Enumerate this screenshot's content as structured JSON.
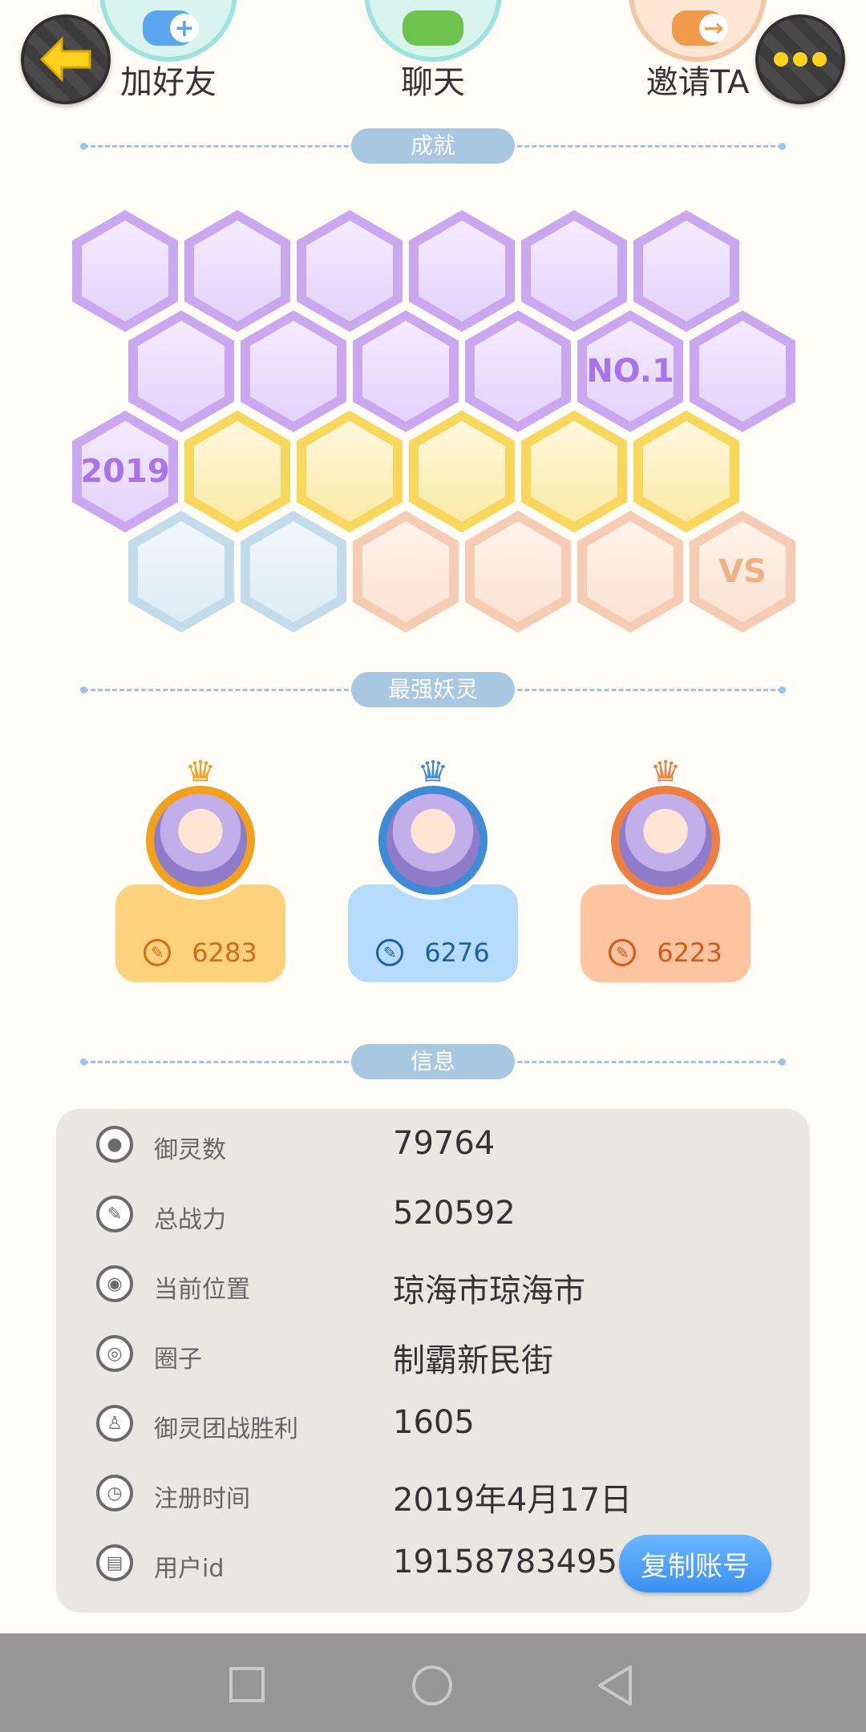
{
  "top_actions": [
    {
      "label": "加好友",
      "icon": "add-friend-icon"
    },
    {
      "label": "聊天",
      "icon": "chat-icon"
    },
    {
      "label": "邀请TA",
      "icon": "invite-icon"
    }
  ],
  "back_button": {
    "icon": "back-arrow-icon"
  },
  "more_button": {
    "icon": "more-dots-icon"
  },
  "sections": {
    "achievements": "成就",
    "strongest": "最强妖灵",
    "info": "信息"
  },
  "achievements": [
    {
      "icon": "sneaker-badge",
      "color": "purple",
      "text": ""
    },
    {
      "icon": "lollipop-badge",
      "color": "purple",
      "text": ""
    },
    {
      "icon": "devil-badge",
      "color": "purple",
      "text": ""
    },
    {
      "icon": "crystal-ball-badge",
      "color": "purple",
      "text": ""
    },
    {
      "icon": "gem-badge",
      "color": "purple",
      "text": ""
    },
    {
      "icon": "yinyang-comet-badge",
      "color": "purple",
      "text": ""
    },
    {
      "icon": "cat-badge",
      "color": "purple",
      "text": ""
    },
    {
      "icon": "fairy-badge",
      "color": "purple",
      "text": ""
    },
    {
      "icon": "monster-badge",
      "color": "purple",
      "text": ""
    },
    {
      "icon": "unicorn-badge",
      "color": "purple",
      "text": ""
    },
    {
      "icon": "no1-badge",
      "color": "purple",
      "text": "NO.1"
    },
    {
      "icon": "fist-badge",
      "color": "purple",
      "text": ""
    },
    {
      "icon": "year-2019-badge",
      "color": "purple",
      "text": "2019"
    },
    {
      "icon": "eclipse-badge",
      "color": "yellow",
      "text": ""
    },
    {
      "icon": "flame-spirit-badge",
      "color": "yellow",
      "text": ""
    },
    {
      "icon": "taiji-box-badge",
      "color": "yellow",
      "text": ""
    },
    {
      "icon": "shield-badge",
      "color": "yellow",
      "text": ""
    },
    {
      "icon": "book-badge",
      "color": "yellow",
      "text": ""
    },
    {
      "icon": "stroller-badge",
      "color": "blue",
      "text": ""
    },
    {
      "icon": "cat-note-badge",
      "color": "blue",
      "text": ""
    },
    {
      "icon": "belt-badge",
      "color": "peach",
      "text": ""
    },
    {
      "icon": "crossed-swords-badge",
      "color": "peach",
      "text": ""
    },
    {
      "icon": "hearts-badge",
      "color": "peach",
      "text": ""
    },
    {
      "icon": "vs-badge",
      "color": "peach",
      "text": "VS"
    }
  ],
  "strongest": [
    {
      "rank_color": "gold",
      "score": "6283"
    },
    {
      "rank_color": "blue",
      "score": "6276"
    },
    {
      "rank_color": "orange",
      "score": "6223"
    }
  ],
  "info": [
    {
      "label": "御灵数",
      "value": "79764",
      "icon": "spirit-count-icon"
    },
    {
      "label": "总战力",
      "value": "520592",
      "icon": "power-icon"
    },
    {
      "label": "当前位置",
      "value": "琼海市琼海市",
      "icon": "location-pin-icon"
    },
    {
      "label": "圈子",
      "value": "制霸新民街",
      "icon": "circle-target-icon"
    },
    {
      "label": "御灵团战胜利",
      "value": "1605",
      "icon": "trophy-figure-icon"
    },
    {
      "label": "注册时间",
      "value": "2019年4月17日",
      "icon": "clock-icon"
    },
    {
      "label": "用户id",
      "value": "19158783495",
      "icon": "id-card-icon"
    }
  ],
  "copy_button": "复制账号",
  "navbar": {
    "icons": [
      "recent-apps-icon",
      "home-icon",
      "back-triangle-icon"
    ]
  }
}
